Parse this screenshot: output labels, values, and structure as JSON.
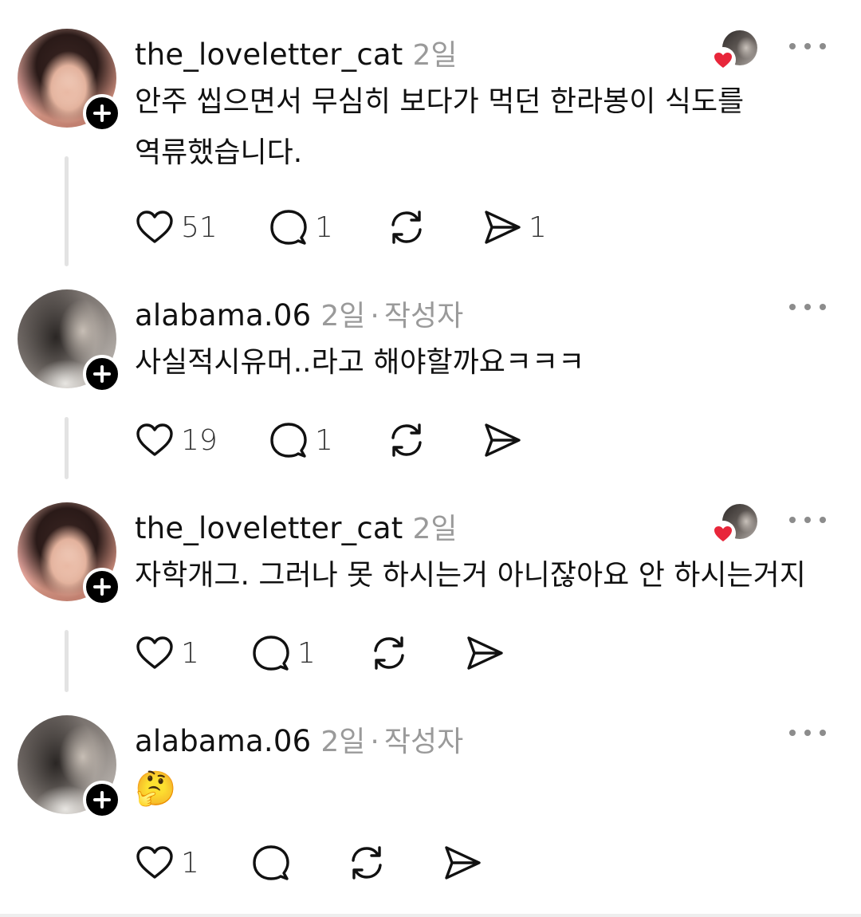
{
  "posts": [
    {
      "username": "the_loveletter_cat",
      "time": "2일",
      "author_tag": "",
      "text": "안주 씹으면서 무심히 보다가 먹던 한라봉이 식도를 역류했습니다.",
      "likes": "51",
      "replies": "1",
      "reposts": "",
      "shares": "1",
      "liked_by_op": true
    },
    {
      "username": "alabama.06",
      "time": "2일",
      "author_tag": "작성자",
      "text": "사실적시유머..라고 해야할까요ㅋㅋㅋ",
      "likes": "19",
      "replies": "1",
      "reposts": "",
      "shares": "",
      "liked_by_op": false
    },
    {
      "username": "the_loveletter_cat",
      "time": "2일",
      "author_tag": "",
      "text": "자학개그. 그러나 못 하시는거 아니잖아요 안 하시는거지",
      "likes": "1",
      "replies": "1",
      "reposts": "",
      "shares": "",
      "liked_by_op": true
    },
    {
      "username": "alabama.06",
      "time": "2일",
      "author_tag": "작성자",
      "text": "🤔",
      "likes": "1",
      "replies": "",
      "reposts": "",
      "shares": "",
      "liked_by_op": false
    }
  ],
  "separator": "·",
  "colors": {
    "text": "#111111",
    "meta": "#9a9a9a",
    "heart_badge": "#e8263a",
    "thread_line": "#e3e3e3"
  },
  "icons": [
    "heart-icon",
    "comment-icon",
    "repost-icon",
    "share-icon",
    "more-icon",
    "plus-icon"
  ]
}
